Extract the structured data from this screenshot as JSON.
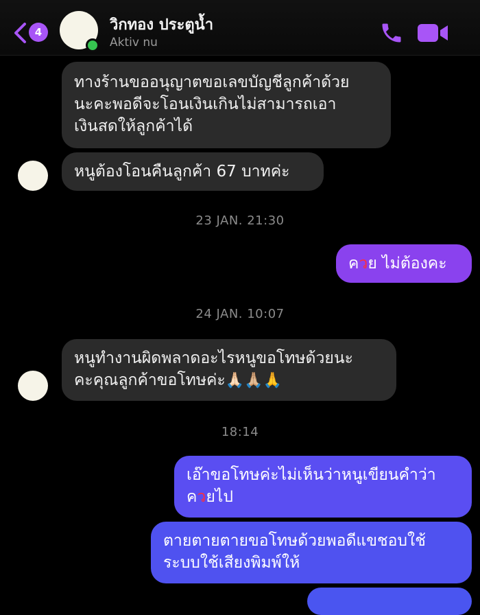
{
  "header": {
    "badge_count": "4",
    "contact_name": "วิกทอง ประตูน้ำ",
    "status": "Aktiv nu"
  },
  "messages": {
    "m1_line1": "ทางร้านขออนุญาตขอเลขบัญชีลูกค้าด้วย",
    "m1_line2": "นะคะพอดีจะโอนเงินเกินไม่สามารถเอา",
    "m1_line3": "เงินสดให้ลูกค้าได้",
    "m2": "หนูต้องโอนคืนลูกค้า 67 บาทค่ะ",
    "ts1": "23 JAN. 21:30",
    "m3_prefix": "ค",
    "m3_mark": "ว",
    "m3_rest": "ย ไม่ต้องคะ",
    "ts2": "24 JAN. 10:07",
    "m4_line1": "หนูทำงานผิดพลาดอะไรหนูขอโทษด้วยนะ",
    "m4_line2": "คะคุณลูกค้าขอโทษค่ะ",
    "m4_emoji": "🙏🏻🙏🏼🙏",
    "ts3": "18:14",
    "m5_line1": "เอ๊าขอโทษค่ะไม่เห็นว่าหนูเขียนคำว่า",
    "m5_prefix": "ค",
    "m5_mark": "ว",
    "m5_rest": "ยไป",
    "m6_line1": "ตายตายตายขอโทษด้วยพอดีแขชอบใช้",
    "m6_line2": "ระบบใช้เสียงพิมพ์ให้"
  },
  "colors": {
    "accent": "#a855f7",
    "incoming_bubble": "#2b2b2b",
    "outgoing_bubble": "#5f49f0",
    "outgoing_violet": "#8a42ee",
    "online": "#36c450"
  },
  "icons": [
    "back-chevron-icon",
    "phone-icon",
    "video-camera-icon"
  ]
}
